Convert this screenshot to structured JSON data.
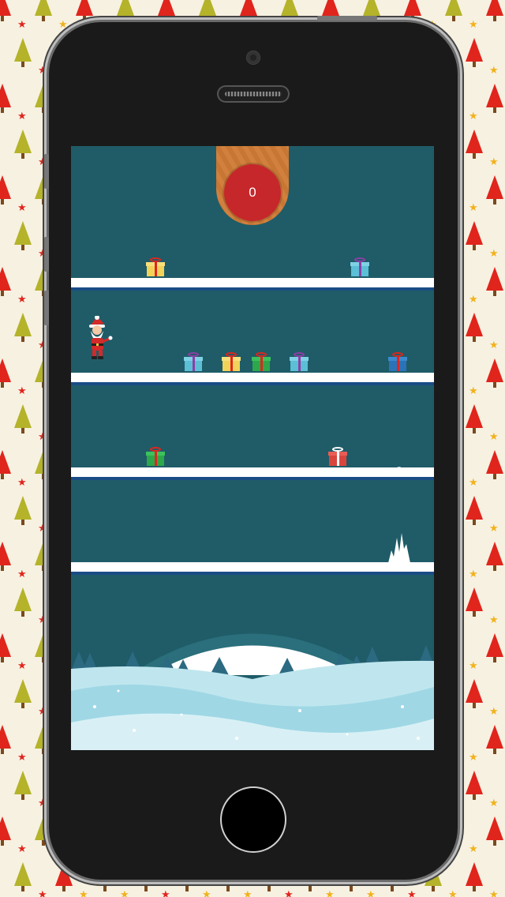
{
  "game": {
    "score": "0"
  },
  "colors": {
    "screen_bg": "#1f5c68",
    "shelf": "#ffffff",
    "shelf_edge": "#1a4c85",
    "score_badge": "#c6272a",
    "score_tab": "#cf7b36",
    "wallpaper": "#f7f1e1"
  },
  "icons": {
    "player": "santa-icon",
    "collectible": "gift-icon",
    "hazard": "ice-spike-icon",
    "device_home": "home-button-icon"
  }
}
